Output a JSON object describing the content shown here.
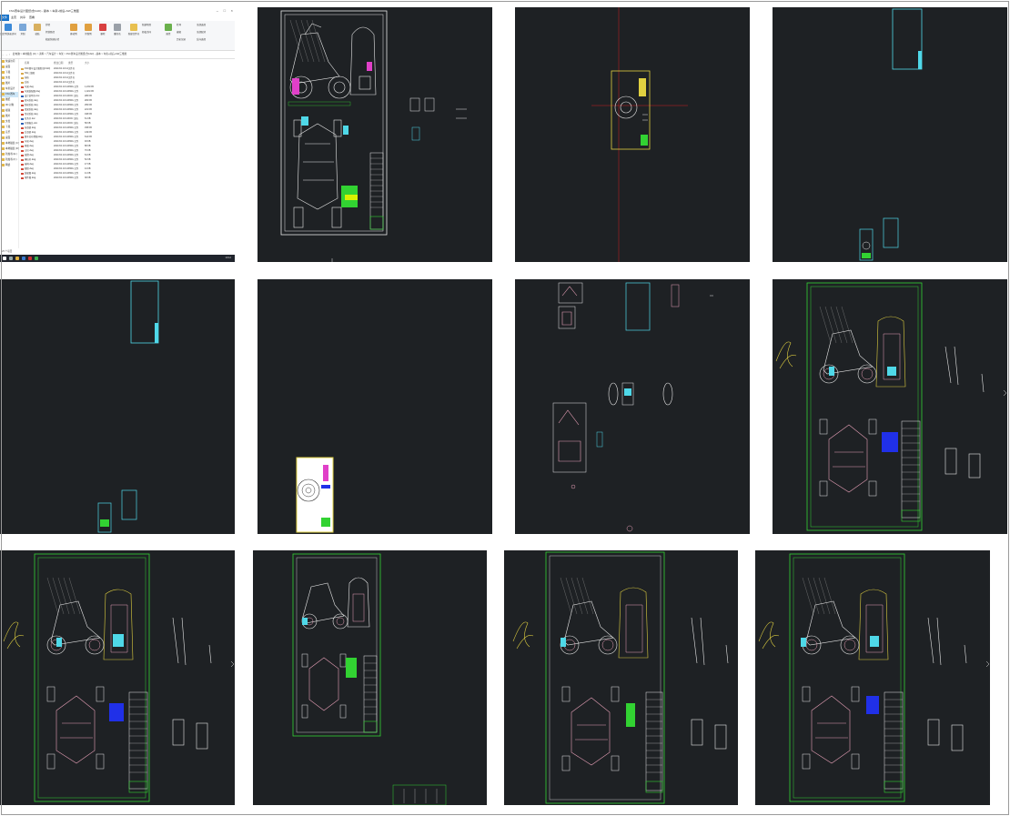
{
  "explorer": {
    "title": "FSC赛车设计图纸(含CAD) - 副本 > 车架+前后+SW三维图",
    "tabs": [
      "文件",
      "主页",
      "共享",
      "查看"
    ],
    "active_tab": "主页",
    "ribbon_items": [
      "固定到快速访问",
      "复制",
      "粘贴",
      "剪切",
      "复制路径",
      "粘贴快捷方式",
      "移动到",
      "复制到",
      "删除",
      "重命名",
      "新建文件夹",
      "新建项目",
      "轻松访问",
      "属性",
      "打开",
      "编辑",
      "历史记录",
      "全部选择",
      "全部取消",
      "反向选择"
    ],
    "address": "此电脑 > 本地磁盘 (D:) > 资料 > 汽车设计 > 车架 > FSC赛车设计图纸(含CAD) - 副本 > 车架+前后+SW三维图",
    "columns": [
      "名称",
      "修改日期",
      "类型",
      "大小"
    ],
    "sidebar": [
      "快速访问",
      "桌面",
      "下载",
      "文档",
      "图片",
      "车架设计",
      "FSC赛车",
      "图纸",
      "3D 对象",
      "视频",
      "图片",
      "文档",
      "下载",
      "音乐",
      "桌面",
      "本地磁盘 (C:)",
      "本地磁盘 (D:)",
      "新加卷 (E:)",
      "新加卷 (F:)",
      "网络"
    ],
    "files": [
      {
        "name": "FSC赛车设计图纸(含CAD)",
        "date": "2021/3/4 10:12",
        "type": "文件夹",
        "size": "",
        "kind": "folder"
      },
      {
        "name": "SW三维图",
        "date": "2021/3/4 10:12",
        "type": "文件夹",
        "size": "",
        "kind": "folder"
      },
      {
        "name": "前桥",
        "date": "2021/3/4 10:12",
        "type": "文件夹",
        "size": "",
        "kind": "folder"
      },
      {
        "name": "后桥",
        "date": "2021/3/4 10:12",
        "type": "文件夹",
        "size": "",
        "kind": "folder"
      },
      {
        "name": "车架.dwg",
        "date": "2021/3/4 10:12",
        "type": "DWG 文件",
        "size": "1,231 KB",
        "kind": "dwg"
      },
      {
        "name": "车架装配图.dwg",
        "date": "2021/3/4 10:12",
        "type": "DWG 文件",
        "size": "1,021 KB",
        "kind": "dwg"
      },
      {
        "name": "设计说明书.doc",
        "date": "2021/3/4 10:12",
        "type": "DOC 文档",
        "size": "286 KB",
        "kind": "doc"
      },
      {
        "name": "转向系统.dwg",
        "date": "2021/3/4 10:12",
        "type": "DWG 文件",
        "size": "284 KB",
        "kind": "dwg"
      },
      {
        "name": "制动系统.dwg",
        "date": "2021/3/4 10:12",
        "type": "DWG 文件",
        "size": "256 KB",
        "kind": "dwg"
      },
      {
        "name": "悬架系统.dwg",
        "date": "2021/3/4 10:12",
        "type": "DWG 文件",
        "size": "221 KB",
        "kind": "dwg"
      },
      {
        "name": "传动系统.dwg",
        "date": "2021/3/4 10:12",
        "type": "DWG 文件",
        "size": "198 KB",
        "kind": "dwg"
      },
      {
        "name": "任务书.doc",
        "date": "2021/3/4 10:12",
        "type": "DOC 文档",
        "size": "61 KB",
        "kind": "doc"
      },
      {
        "name": "开题报告.doc",
        "date": "2021/3/4 10:12",
        "type": "DOC 文档",
        "size": "58 KB",
        "kind": "doc"
      },
      {
        "name": "前悬架.dwg",
        "date": "2021/3/4 10:12",
        "type": "DWG 文件",
        "size": "158 KB",
        "kind": "dwg"
      },
      {
        "name": "后悬架.dwg",
        "date": "2021/3/4 10:12",
        "type": "DWG 文件",
        "size": "149 KB",
        "kind": "dwg"
      },
      {
        "name": "赛车总布置图.dwg",
        "date": "2021/3/4 10:12",
        "type": "DWG 文件",
        "size": "612 KB",
        "kind": "dwg"
      },
      {
        "name": "车轮.dwg",
        "date": "2021/3/4 10:12",
        "type": "DWG 文件",
        "size": "93 KB",
        "kind": "dwg"
      },
      {
        "name": "轮毂.dwg",
        "date": "2021/3/4 10:12",
        "type": "DWG 文件",
        "size": "88 KB",
        "kind": "dwg"
      },
      {
        "name": "立柱.dwg",
        "date": "2021/3/4 10:12",
        "type": "DWG 文件",
        "size": "76 KB",
        "kind": "dwg"
      },
      {
        "name": "摇臂.dwg",
        "date": "2021/3/4 10:12",
        "type": "DWG 文件",
        "size": "64 KB",
        "kind": "dwg"
      },
      {
        "name": "横拉杆.dwg",
        "date": "2021/3/4 10:12",
        "type": "DWG 文件",
        "size": "52 KB",
        "kind": "dwg"
      },
      {
        "name": "座椅.dwg",
        "date": "2021/3/4 10:12",
        "type": "DWG 文件",
        "size": "47 KB",
        "kind": "dwg"
      },
      {
        "name": "图纸.dwg",
        "date": "2021/3/4 10:12",
        "type": "DWG 文件",
        "size": "44 KB",
        "kind": "dwg"
      },
      {
        "name": "装配图.dwg",
        "date": "2021/3/4 10:12",
        "type": "DWG 文件",
        "size": "41 KB",
        "kind": "dwg"
      },
      {
        "name": "零件图.dwg",
        "date": "2021/3/4 10:12",
        "type": "DWG 文件",
        "size": "38 KB",
        "kind": "dwg"
      }
    ],
    "status": "25 个项目",
    "clock": "10:12"
  },
  "colors": {
    "cad_bg": "#1e2124",
    "frame_white": "#e8e8e8",
    "frame_green": "#32d232",
    "cyan": "#4fd8e8",
    "magenta": "#e040c8",
    "pink": "#e8a0b8",
    "yellow": "#e0d040",
    "blue": "#2030e8",
    "red": "#d02020",
    "explorer_accent": "#1a73c8"
  }
}
